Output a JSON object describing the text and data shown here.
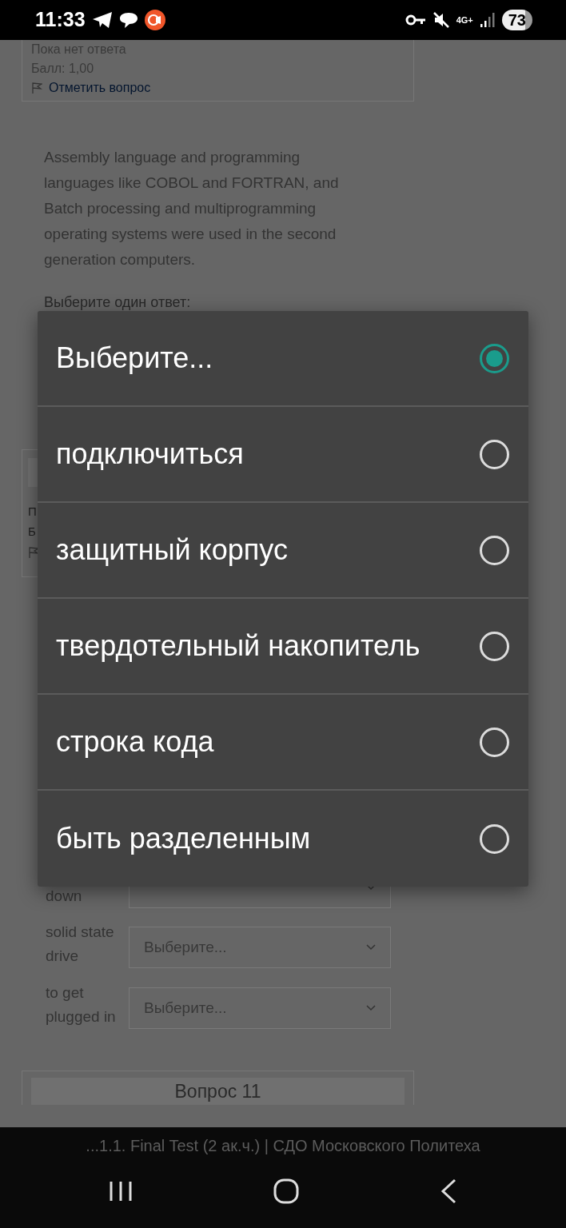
{
  "status_bar": {
    "time": "11:33",
    "network": "4G+",
    "battery": "73"
  },
  "prev_question": {
    "state": "Пока нет ответа",
    "score": "Балл: 1,00",
    "flag_link": "Отметить вопрос"
  },
  "question_text": "Assembly language and programming languages like COBOL and FORTRAN, and Batch processing and multiprogramming operating systems were used in the second generation computers.",
  "prompt": "Выберите один ответ:",
  "hidden_question": {
    "state": "П",
    "score": "Б"
  },
  "match_rows": [
    {
      "label": "down"
    },
    {
      "label": "solid state drive",
      "value": "Выберите..."
    },
    {
      "label": "to get plugged in",
      "value": "Выберите..."
    }
  ],
  "next_question": {
    "title": "Вопрос 11"
  },
  "picker": {
    "options": [
      {
        "label": "Выберите...",
        "selected": true
      },
      {
        "label": "подключиться",
        "selected": false
      },
      {
        "label": "защитный корпус",
        "selected": false
      },
      {
        "label": "твердотельный накопитель",
        "selected": false
      },
      {
        "label": "строка кода",
        "selected": false
      },
      {
        "label": "быть разделенным",
        "selected": false
      }
    ]
  },
  "browser_title": "...1.1. Final Test (2 ак.ч.) | СДО Московского Политеха"
}
